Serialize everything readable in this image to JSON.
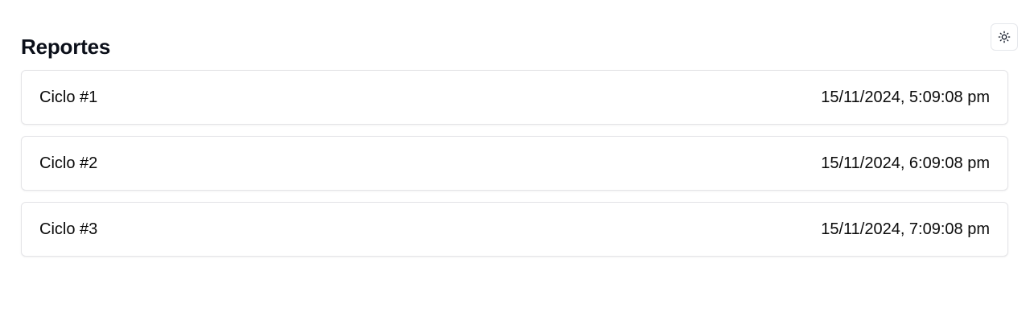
{
  "header": {
    "title": "Reportes",
    "theme_toggle_icon": "sun-icon"
  },
  "reports": [
    {
      "name": "Ciclo #1",
      "date": "15/11/2024, 5:09:08 pm"
    },
    {
      "name": "Ciclo #2",
      "date": "15/11/2024, 6:09:08 pm"
    },
    {
      "name": "Ciclo #3",
      "date": "15/11/2024, 7:09:08 pm"
    }
  ]
}
